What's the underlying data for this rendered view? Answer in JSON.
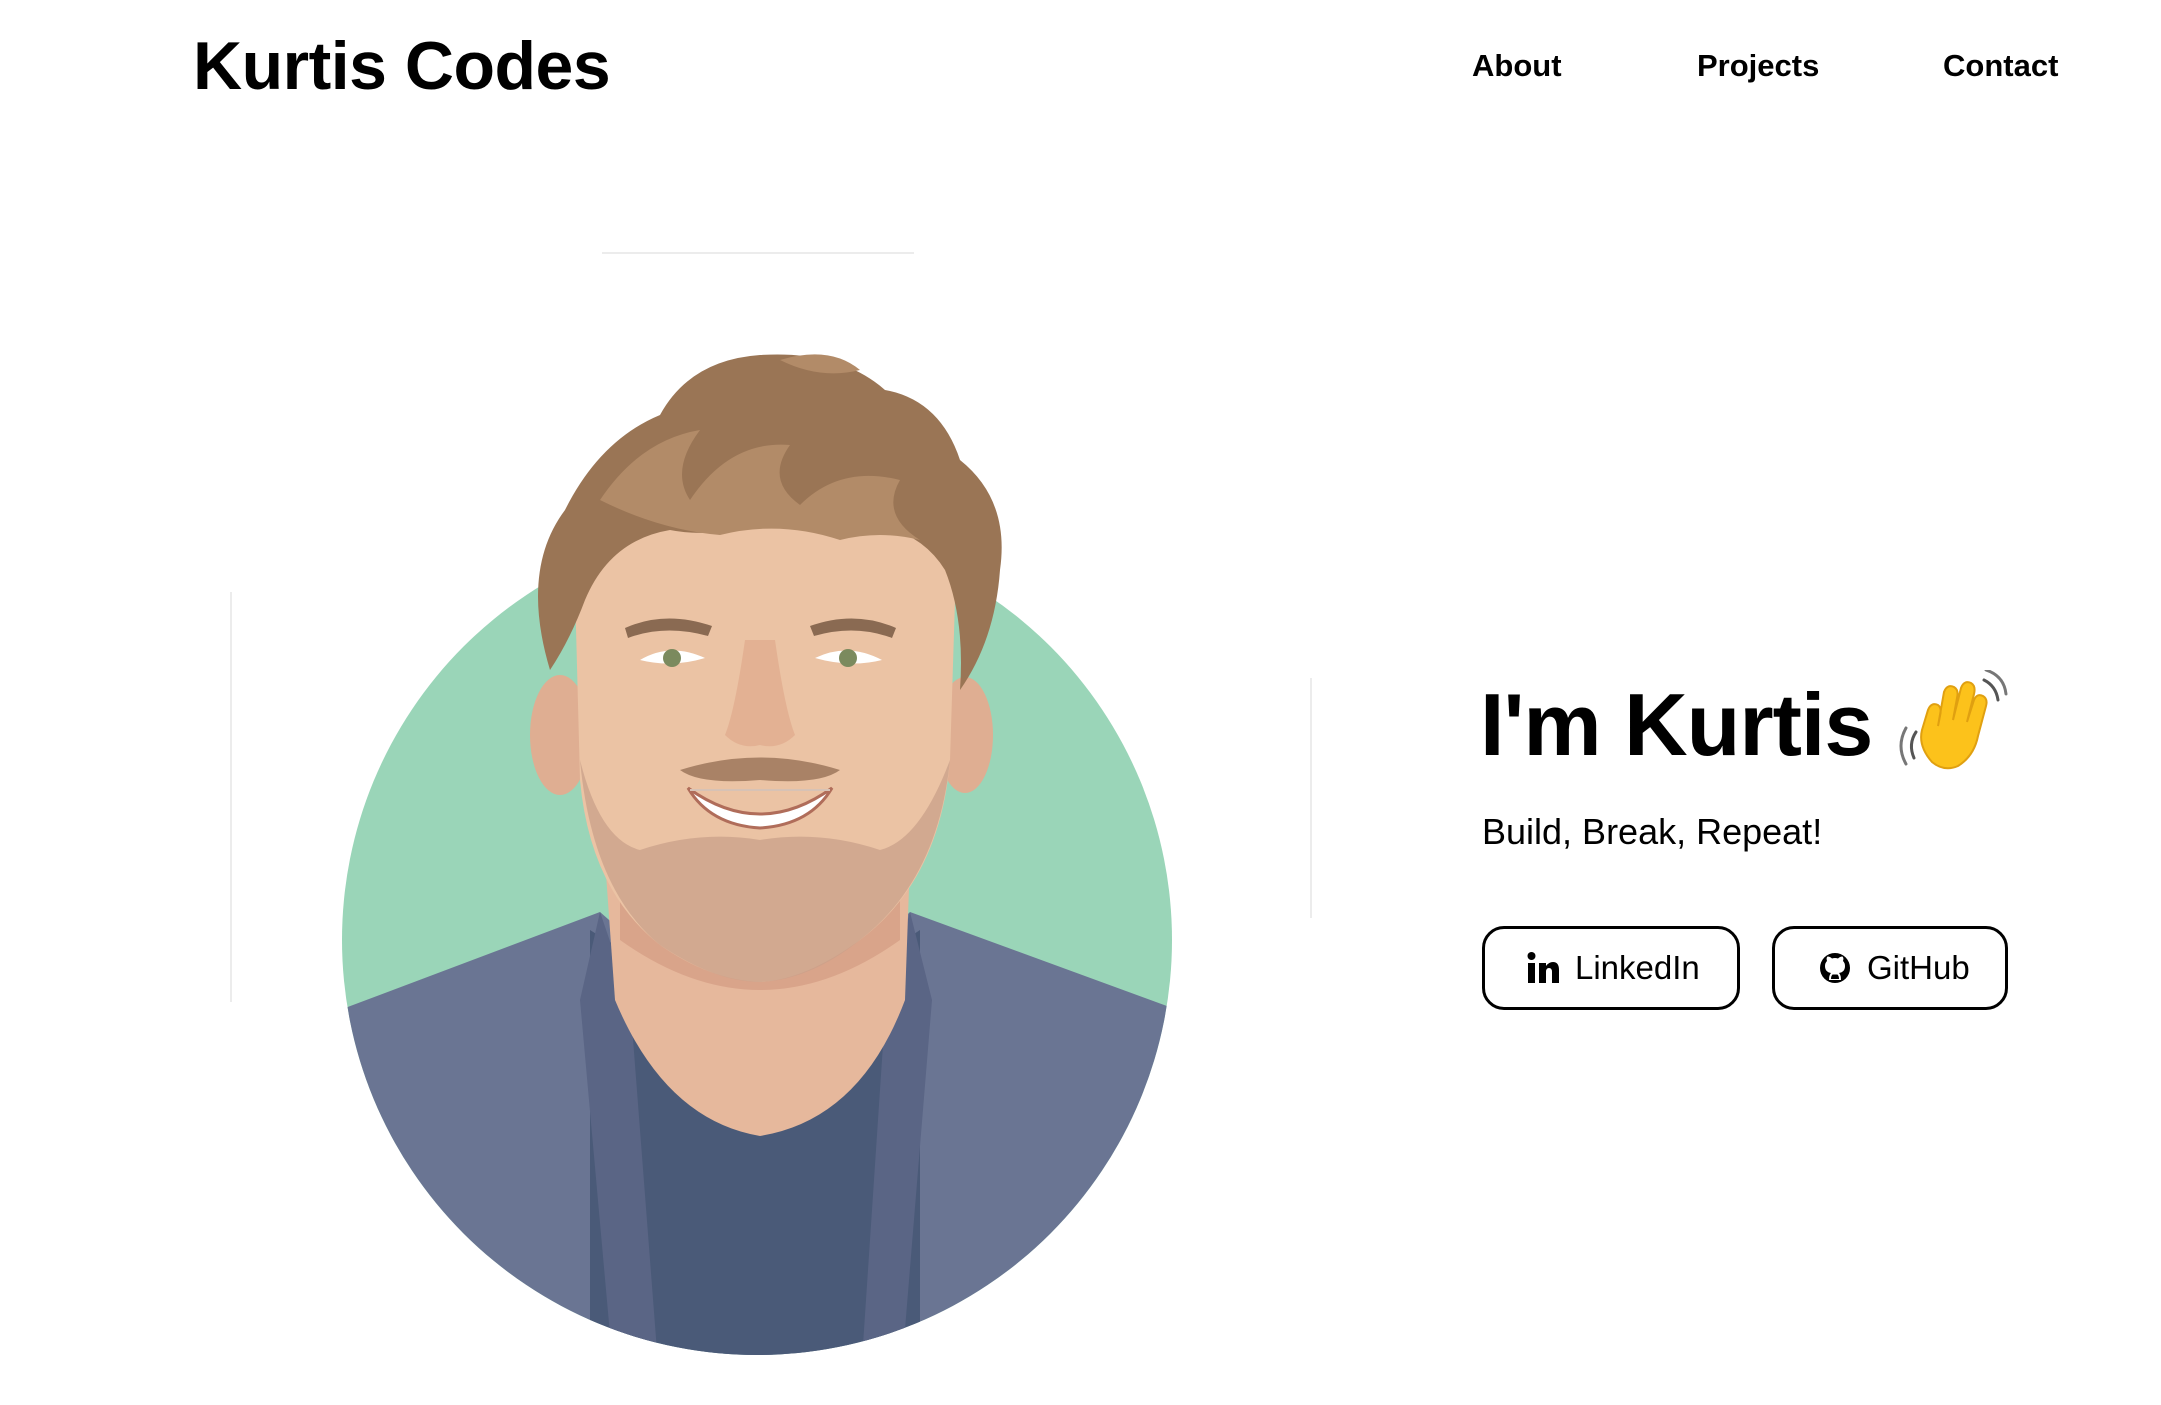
{
  "header": {
    "brand": "Kurtis Codes",
    "nav": [
      {
        "label": "About"
      },
      {
        "label": "Projects"
      },
      {
        "label": "Contact"
      }
    ]
  },
  "hero": {
    "greeting": "I'm Kurtis",
    "wave_icon": "waving-hand-icon",
    "tagline": "Build, Break, Repeat!",
    "portrait_alt": "Illustrated portrait of Kurtis",
    "buttons": [
      {
        "label": "LinkedIn",
        "icon": "linkedin-icon"
      },
      {
        "label": "GitHub",
        "icon": "github-icon"
      }
    ]
  },
  "colors": {
    "background": "#ffffff",
    "text": "#000000",
    "portrait_circle": "#9ad5b8",
    "jacket": "#6a7593",
    "shirt": "#4a5a78",
    "skin": "#ebc3a4",
    "hair": "#9a7555"
  }
}
